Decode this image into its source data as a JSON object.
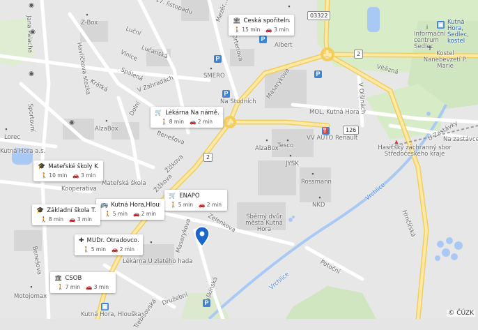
{
  "streets": {
    "s1": "17. listopadu",
    "s2": "Jana Palacha",
    "s3": "Mezěr…",
    "s4": "Luční",
    "s5": "Lučanská",
    "s6": "Havlíčkova stezka",
    "s7": "Vinice",
    "s8": "Spálená",
    "s9": "Krátká",
    "s10": "V Zahradách",
    "s11": "Ortenova",
    "s12": "Masarykova",
    "s13": "Na Studních",
    "s14": "Sportovní",
    "s15": "Dolní",
    "s16": "Benešova",
    "s17": "Žižkova",
    "s18": "Žižkova",
    "s19": "Kooperativa",
    "s20": "Masarykova",
    "s21": "Zelenkova",
    "s22": "Puškinská",
    "s23": "Trebišovská",
    "s24": "Družební",
    "s25": "Benešova",
    "s26": "Vítězná",
    "s27": "V Olšinách",
    "s28": "U Zastávky",
    "s29": "Na zastávce",
    "s30": "Vrchlice",
    "s31": "Vrchlice",
    "s32": "Hrnčířská",
    "s33": "Potoční",
    "s34": "Kostel Nanebevzetí P. Marie",
    "s35": "Informační centrum Sedlec",
    "s36": "Kutná Hora, Sedlec, kostel",
    "s37": "Albert",
    "s38": "SMERO",
    "s39": "Z-Box",
    "s40": "AlzaBox",
    "s41": "Mateřská škola",
    "s42": "Lékárna U zlatého hada",
    "s43": "Sběrný dvůr města Kutná Hora",
    "s44": "MOL, Kutná Hora",
    "s45": "VV AUTO Renault",
    "s46": "Tesco",
    "s47": "JYSK",
    "s48": "Rossmann",
    "s49": "NKD",
    "s50": "Hasičský záchranný sbor Středočeského kraje",
    "s51": "Motojomax",
    "s52": "Kutná Hora, Hlouška",
    "s53": "Lorec",
    "s54": "Kutná Hora a.s.",
    "s55": "AlzaBox",
    "s56": "Družební"
  },
  "shields": {
    "r1": "03322",
    "r2": "2",
    "r3": "2",
    "r4": "126"
  },
  "cards": [
    {
      "title": "Česká spořitelna",
      "walk": "15 min",
      "car": "3 min"
    },
    {
      "title": "Lékárna Na námě…",
      "walk": "8 min",
      "car": "2 min"
    },
    {
      "title": "Mateřské školy K…",
      "walk": "10 min",
      "car": "3 min"
    },
    {
      "title": "ENAPO",
      "walk": "5 min",
      "car": "2 min"
    },
    {
      "title": "Kutná Hora,Hlouš…",
      "walk": "5 min",
      "car": "2 min"
    },
    {
      "title": "Základní škola T. …",
      "walk": "8 min",
      "car": "3 min"
    },
    {
      "title": "MUDr. Otradovco…",
      "walk": "5 min",
      "car": "2 min"
    },
    {
      "title": "ČSOB",
      "walk": "7 min",
      "car": "3 min"
    }
  ],
  "copyright": "© ČÚZK",
  "colors": {
    "water": "#a9c9f5",
    "green": "#cfe6c0",
    "road_major": "#f7d774",
    "pin": "#1a66c9"
  }
}
